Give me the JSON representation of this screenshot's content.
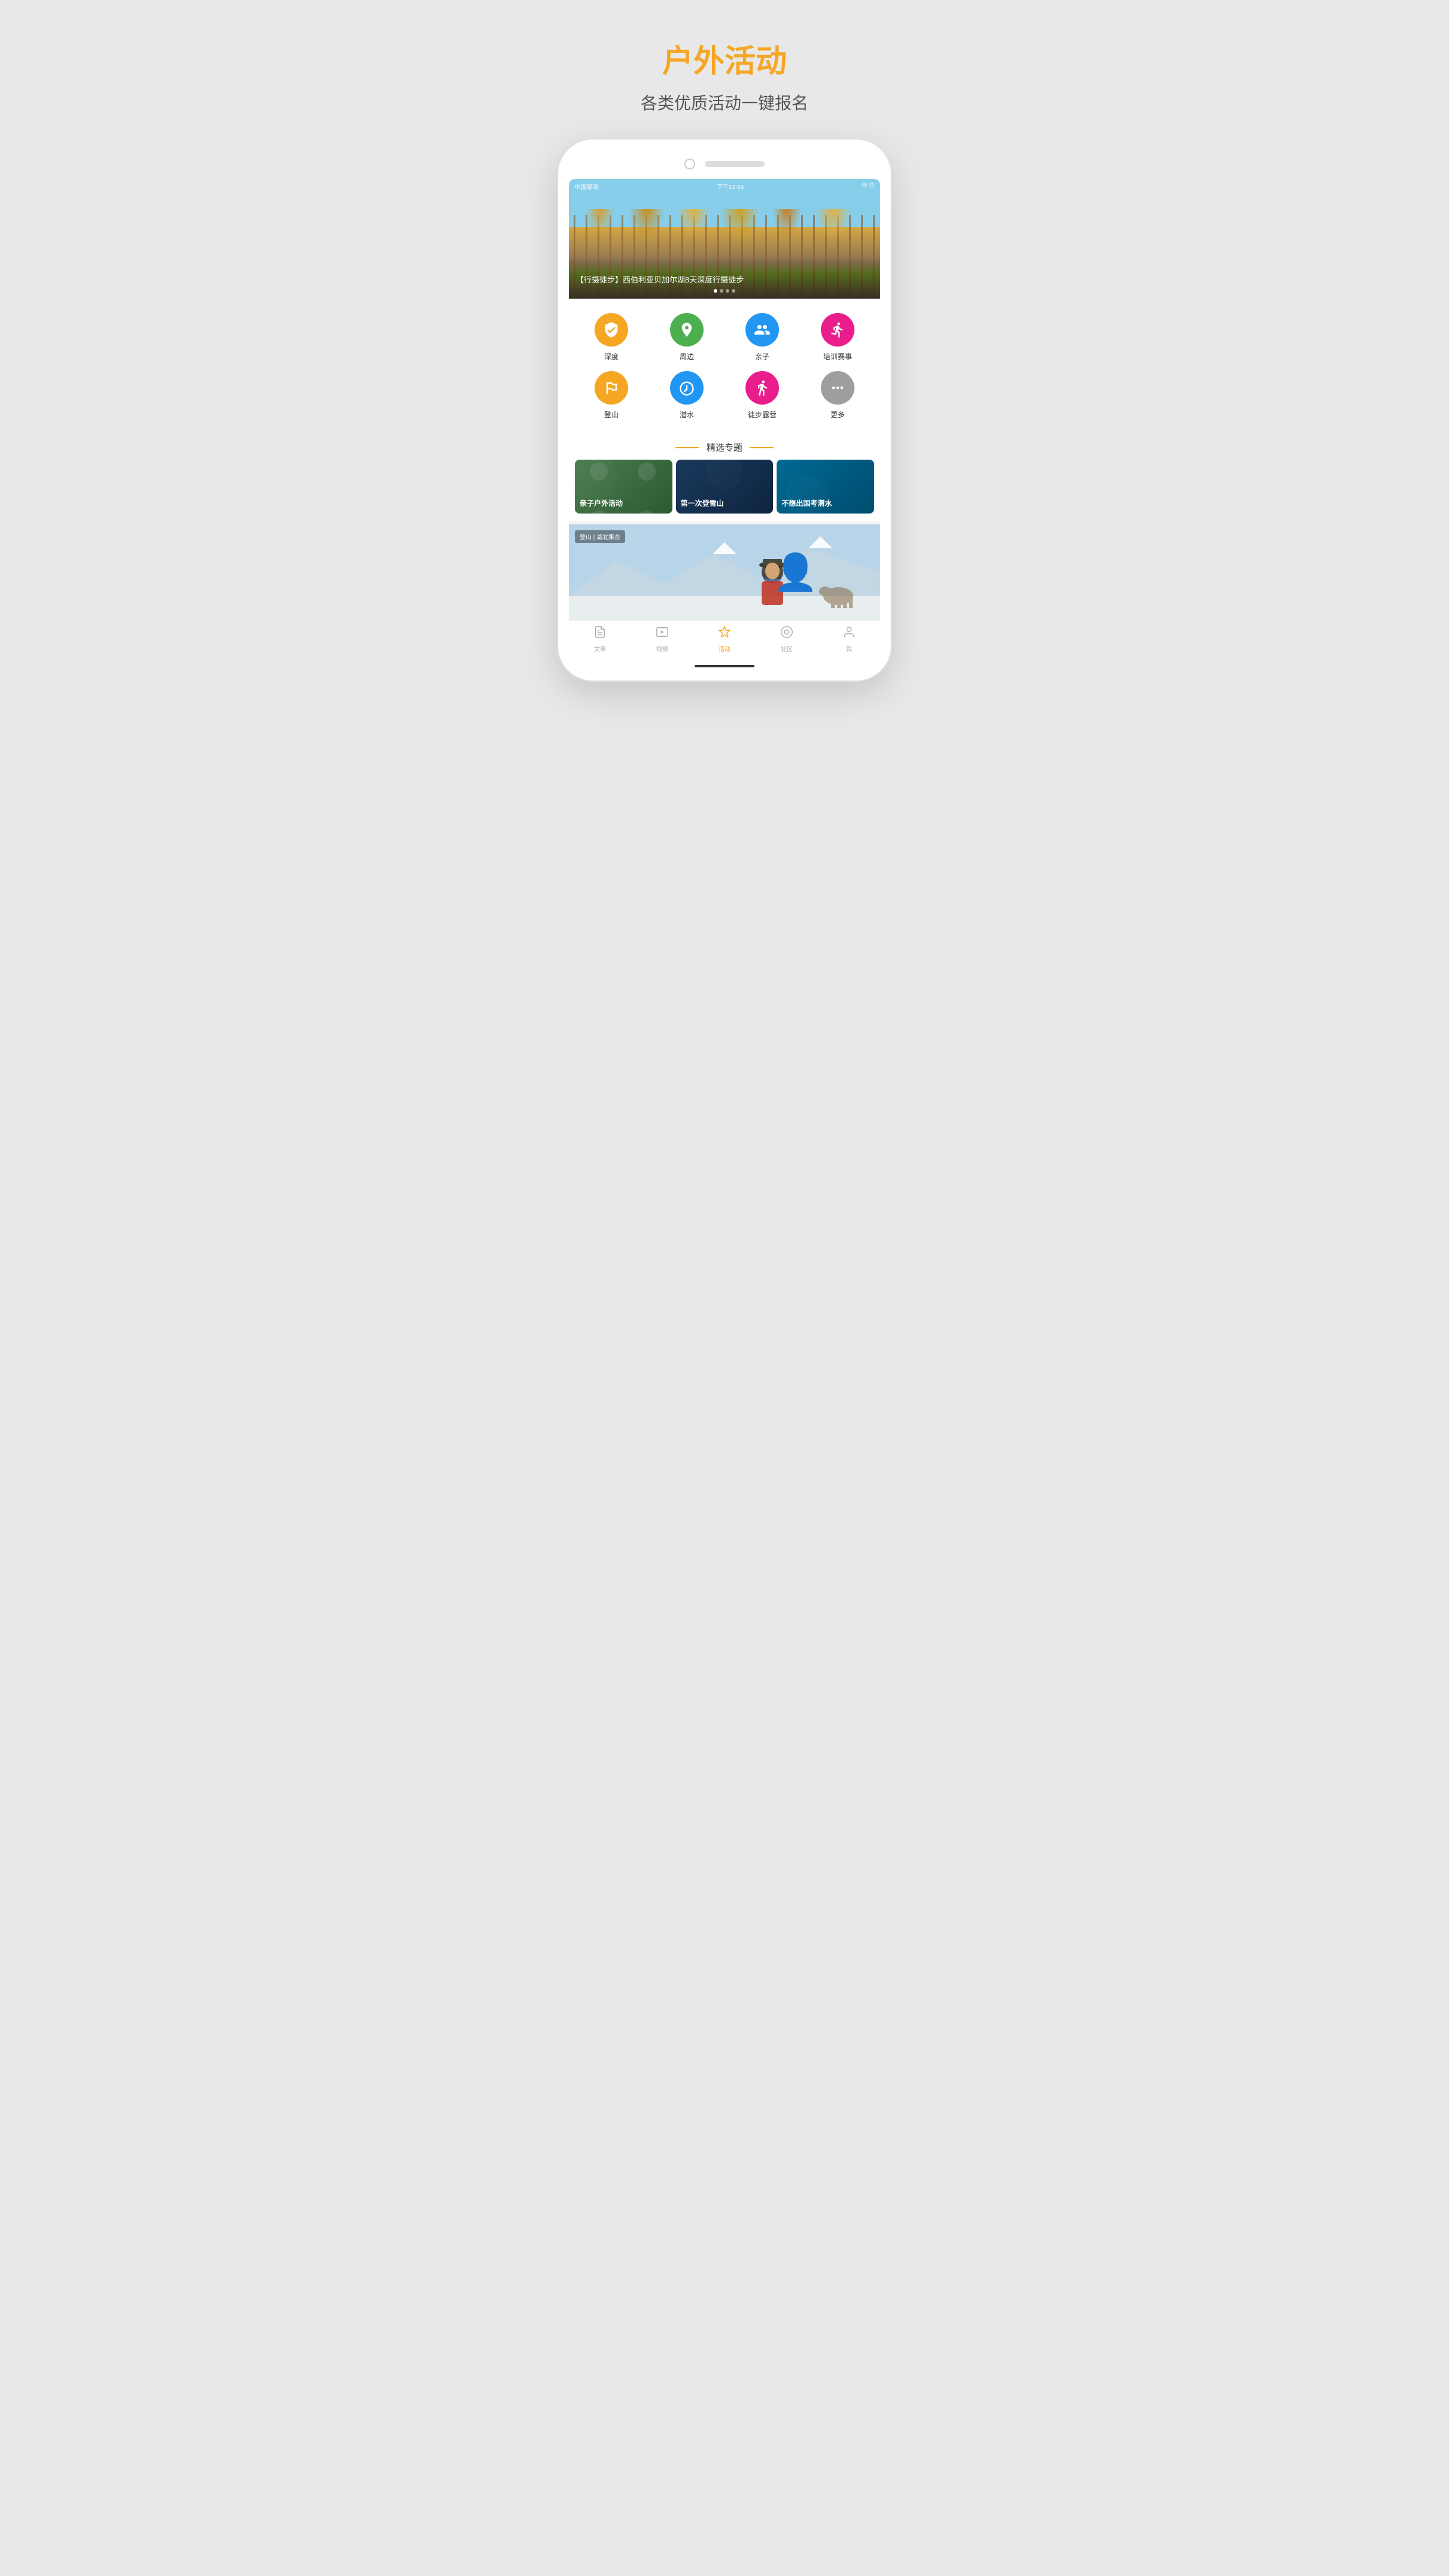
{
  "header": {
    "title": "户外活动",
    "subtitle": "各类优质活动一键报名"
  },
  "phone": {
    "statusBar": {
      "carrier": "中国移动",
      "time": "下午12:24",
      "icons": "◎ ◎"
    }
  },
  "heroBanner": {
    "caption": "【行摄徒步】西伯利亚贝加尔湖8天深度行摄徒步",
    "tag": "登山 | 湖北集合",
    "dots": [
      "●",
      "○",
      "○",
      "○"
    ],
    "activeDot": 0
  },
  "categories": [
    {
      "id": "depth",
      "label": "深度",
      "icon": "shield-check",
      "color": "orange"
    },
    {
      "id": "nearby",
      "label": "周边",
      "icon": "location",
      "color": "green"
    },
    {
      "id": "family",
      "label": "亲子",
      "icon": "family",
      "color": "blue"
    },
    {
      "id": "training",
      "label": "培训赛事",
      "icon": "person-sport",
      "color": "pink"
    },
    {
      "id": "climbing",
      "label": "登山",
      "icon": "mountain",
      "color": "orange2"
    },
    {
      "id": "diving",
      "label": "潜水",
      "icon": "diving",
      "color": "blue2"
    },
    {
      "id": "camping",
      "label": "徒步露营",
      "icon": "hiking",
      "color": "pink2"
    },
    {
      "id": "more",
      "label": "更多",
      "icon": "dots",
      "color": "gray"
    }
  ],
  "sectionTitle": "精选专题",
  "topics": [
    {
      "id": "family-outdoor",
      "label": "亲子户外活动",
      "bg": "green-dark"
    },
    {
      "id": "first-snow",
      "label": "第一次登雪山",
      "bg": "blue-dark"
    },
    {
      "id": "domestic-dive",
      "label": "不想出国考潜水",
      "bg": "cyan-dark"
    }
  ],
  "activityCard": {
    "tag": "登山 | 湖北集合"
  },
  "bottomNav": [
    {
      "id": "articles",
      "label": "文章",
      "icon": "article",
      "active": false
    },
    {
      "id": "videos",
      "label": "视频",
      "icon": "video",
      "active": false
    },
    {
      "id": "activities",
      "label": "活动",
      "icon": "activity",
      "active": true
    },
    {
      "id": "community",
      "label": "社区",
      "icon": "community",
      "active": false
    },
    {
      "id": "profile",
      "label": "我",
      "icon": "person",
      "active": false
    }
  ],
  "colors": {
    "orange": "#f5a623",
    "green": "#4caf50",
    "blue": "#2196f3",
    "pink": "#e91e8c",
    "gray": "#9e9e9e"
  }
}
